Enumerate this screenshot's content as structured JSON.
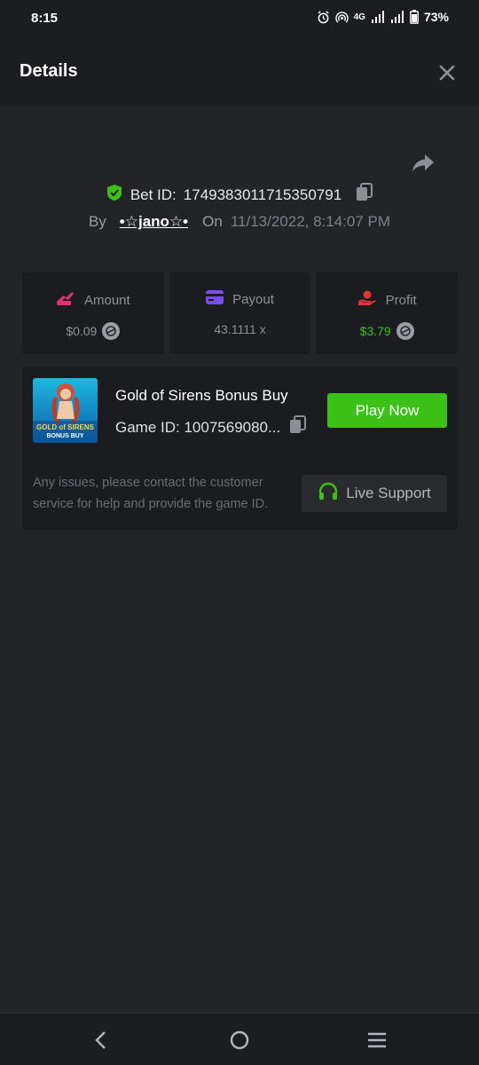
{
  "status_bar": {
    "time": "8:15",
    "network": "4G",
    "battery": "73%"
  },
  "header": {
    "title": "Details"
  },
  "bet": {
    "id_label": "Bet ID:",
    "id_value": "1749383011715350791",
    "by_label": "By",
    "user": "•☆jano☆•",
    "on_label": "On",
    "datetime": "11/13/2022, 8:14:07 PM"
  },
  "stats": {
    "amount_label": "Amount",
    "amount_value": "$0.09",
    "payout_label": "Payout",
    "payout_value": "43.1111 x",
    "profit_label": "Profit",
    "profit_value": "$3.79"
  },
  "game": {
    "name": "Gold of Sirens Bonus Buy",
    "id_text": "Game ID: 1007569080...",
    "thumb_line1": "GOLD of SIRENS",
    "thumb_line2": "BONUS BUY",
    "play_label": "Play Now",
    "notice": "Any issues, please contact the customer service for help and provide the game ID.",
    "support_label": "Live Support"
  },
  "colors": {
    "accent_green": "#3bc117",
    "amount_icon": "#e0306e",
    "payout_icon": "#7b4de8",
    "profit_icon": "#e03535"
  }
}
